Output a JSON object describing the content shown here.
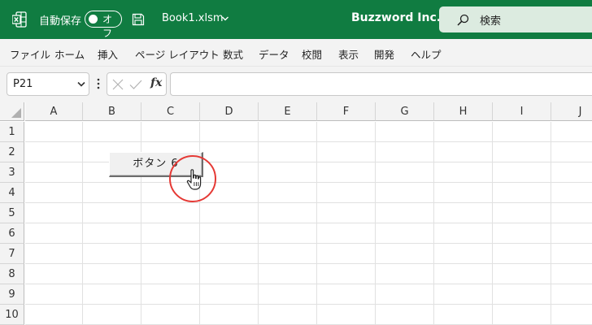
{
  "titlebar": {
    "autosave_label": "自動保存",
    "autosave_state": "オフ",
    "filename": "Book1.xlsm",
    "company": "Buzzword Inc.",
    "search_placeholder": "検索",
    "bg_color": "#107c41"
  },
  "menu": {
    "items": [
      "ファイル",
      "ホーム",
      "挿入",
      "ページ レイアウト",
      "数式",
      "データ",
      "校閲",
      "表示",
      "開発",
      "ヘルプ"
    ]
  },
  "formula_bar": {
    "namebox": "P21",
    "fx_label": "fx",
    "formula": ""
  },
  "sheet": {
    "columns": [
      "A",
      "B",
      "C",
      "D",
      "E",
      "F",
      "G",
      "H",
      "I",
      "J"
    ],
    "rows": [
      "1",
      "2",
      "3",
      "4",
      "5",
      "6",
      "7",
      "8",
      "9",
      "10"
    ]
  },
  "form_button": {
    "label": "ボタン 6",
    "highlight_color": "#e53935"
  }
}
